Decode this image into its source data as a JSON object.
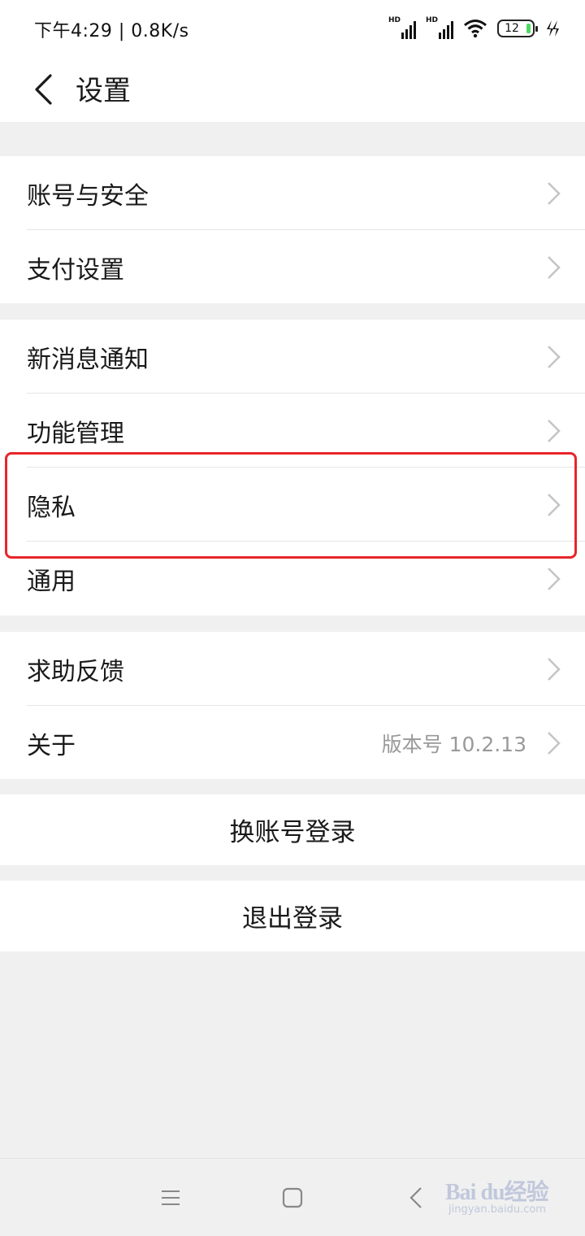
{
  "status_bar": {
    "time_speed": "下午4:29 | 0.8K/s",
    "signal1_tag": "HD",
    "signal2_tag": "HD",
    "battery_level": "12",
    "icons": [
      "signal-hd-icon",
      "signal-hd-icon",
      "wifi-icon",
      "battery-icon",
      "charging-icon"
    ]
  },
  "header": {
    "title": "设置",
    "back_icon": "back-chevron-icon"
  },
  "groups": [
    {
      "items": [
        {
          "label": "账号与安全"
        },
        {
          "label": "支付设置"
        }
      ]
    },
    {
      "items": [
        {
          "label": "新消息通知"
        },
        {
          "label": "功能管理"
        },
        {
          "label": "隐私"
        },
        {
          "label": "通用"
        }
      ]
    },
    {
      "items": [
        {
          "label": "求助反馈"
        },
        {
          "label": "关于",
          "value": "版本号 10.2.13"
        }
      ]
    }
  ],
  "actions": {
    "switch_account": "换账号登录",
    "logout": "退出登录"
  },
  "annotation": {
    "highlighted_item": "隐私",
    "color": "#e8262b"
  },
  "nav_bar": {
    "icons": [
      "menu-icon",
      "home-square-icon",
      "back-triangle-icon"
    ]
  },
  "watermark": {
    "brand": "Bai du经验",
    "url": "jingyan.baidu.com"
  },
  "colors": {
    "background": "#f0f0f0",
    "card": "#ffffff",
    "secondary_text": "#999999",
    "chevron": "#c4c4c4"
  }
}
